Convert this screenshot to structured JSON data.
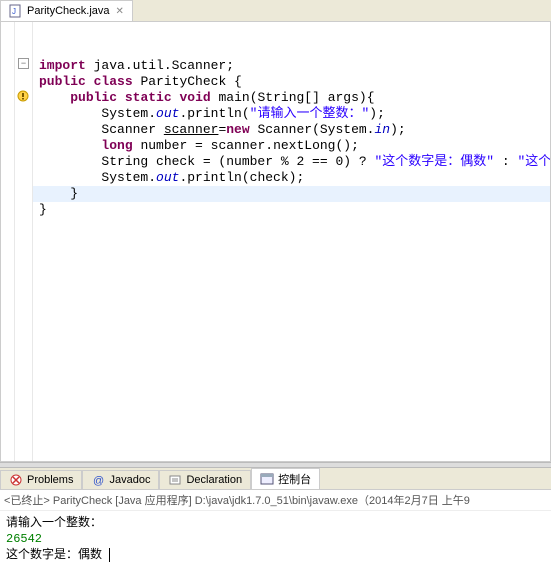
{
  "editor_tab": {
    "filename": "ParityCheck.java"
  },
  "code": {
    "l1_a": "import",
    "l1_b": " java.util.Scanner;",
    "l2_a": "public",
    "l2_b": " ",
    "l2_c": "class",
    "l2_d": " ParityCheck {",
    "l3_a": "    ",
    "l3_b": "public",
    "l3_c": " ",
    "l3_d": "static",
    "l3_e": " ",
    "l3_f": "void",
    "l3_g": " main(String[] args){",
    "l4_a": "        System.",
    "l4_b": "out",
    "l4_c": ".println(",
    "l4_d": "\"请输入一个整数：\"",
    "l4_e": ");",
    "l5_a": "        Scanner ",
    "l5_b": "scanner",
    "l5_c": "=",
    "l5_d": "new",
    "l5_e": " Scanner(System.",
    "l5_f": "in",
    "l5_g": ");",
    "l6_a": "        ",
    "l6_b": "long",
    "l6_c": " number = scanner.nextLong();",
    "l7_a": "        String check = (number % 2 == 0) ? ",
    "l7_b": "\"这个数字是：偶数\"",
    "l7_c": " : ",
    "l7_d": "\"这个数字是：奇数\"",
    "l7_e": ";",
    "l8_a": "        System.",
    "l8_b": "out",
    "l8_c": ".println(check);",
    "l9": "    }",
    "l10": "}"
  },
  "bottom_tabs": {
    "problems": "Problems",
    "javadoc": "Javadoc",
    "declaration": "Declaration",
    "console": "控制台"
  },
  "console": {
    "launch": "<已终止> ParityCheck [Java 应用程序] D:\\java\\jdk1.7.0_51\\bin\\javaw.exe（2014年2月7日 上午9",
    "prompt": "请输入一个整数：",
    "input": "26542",
    "result": "这个数字是：偶数"
  }
}
